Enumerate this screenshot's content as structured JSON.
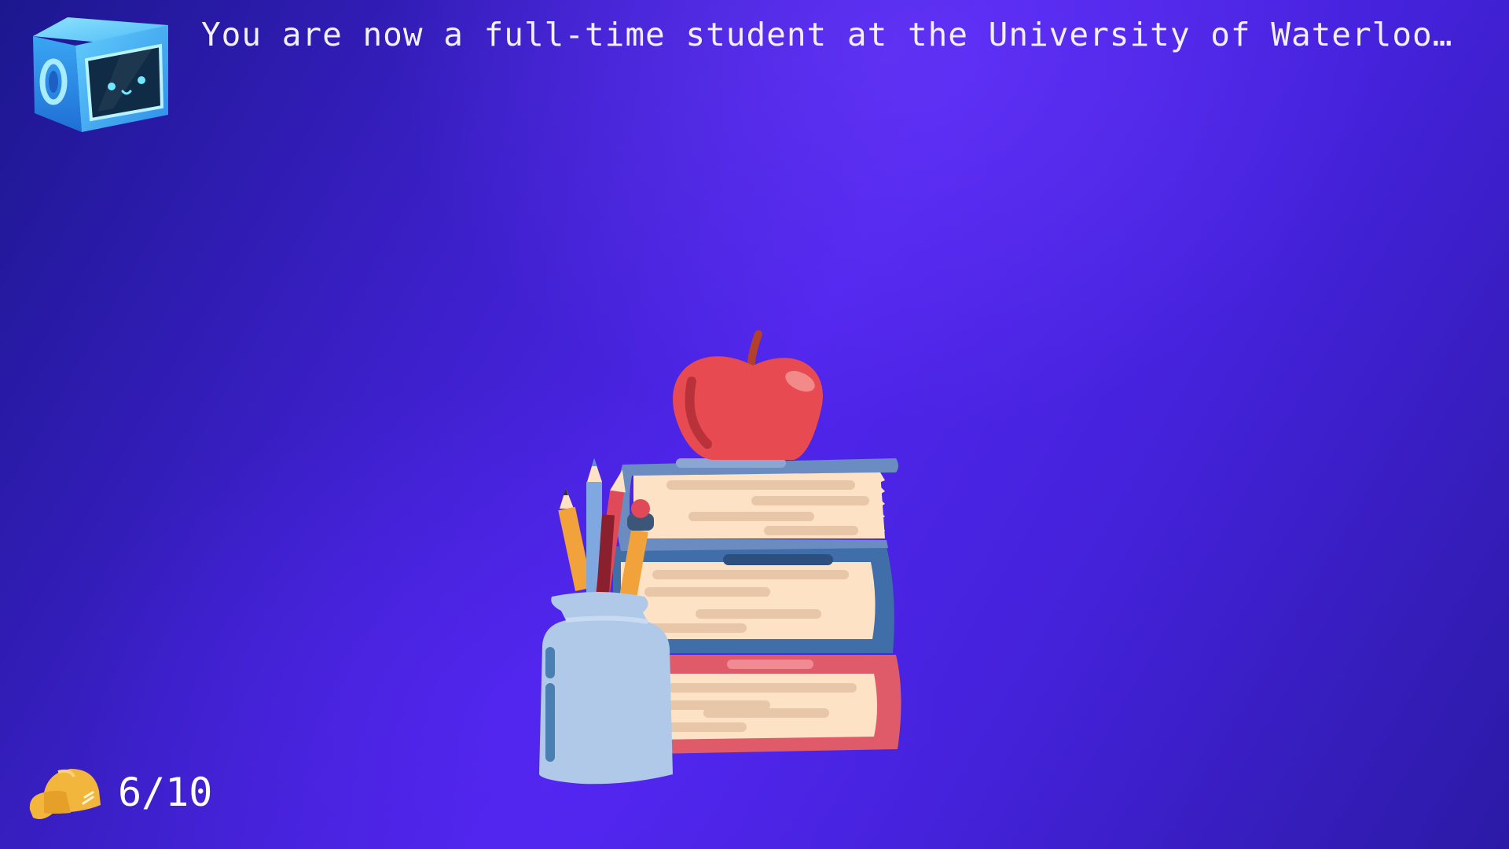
{
  "narration": {
    "text": "You are now a full-time student at the University of Waterloo…"
  },
  "progress": {
    "icon": "hard-hat-icon",
    "current": 6,
    "total": 10,
    "label": "6/10"
  },
  "colors": {
    "background_dark": "#1c178f",
    "background_light": "#5025ec",
    "text": "#f2efff",
    "apple": "#e84a52",
    "hardhat": "#f2b63c"
  }
}
